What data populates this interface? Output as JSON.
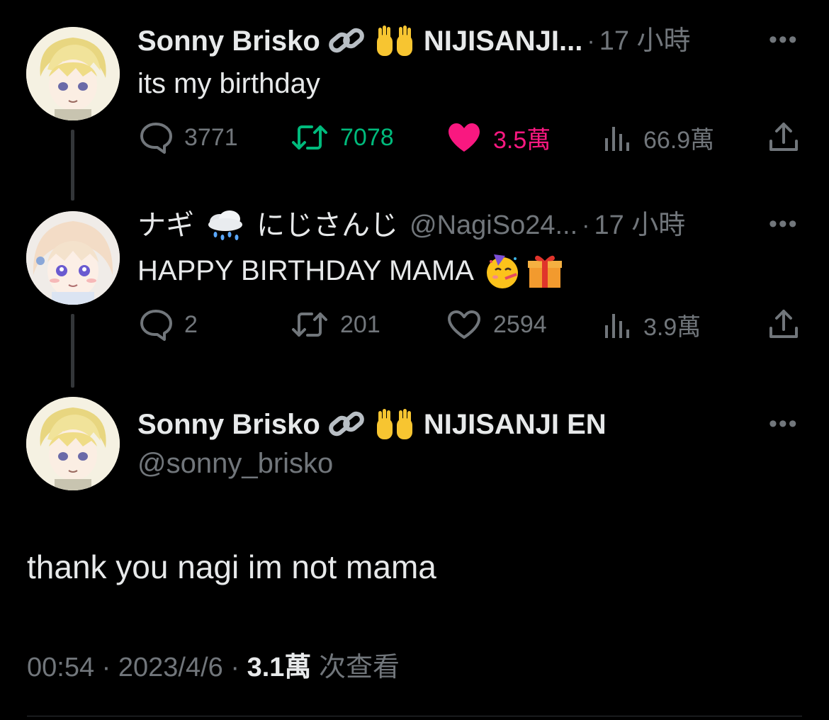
{
  "tweets": [
    {
      "name": "Sonny Brisko",
      "affiliation": "NIJISANJI...",
      "time": "17 小時",
      "text": "its my birthday",
      "replies": "3771",
      "retweets": "7078",
      "likes": "3.5萬",
      "views": "66.9萬"
    },
    {
      "name": "ナギ",
      "affiliation": "にじさんじ",
      "handle": "@NagiSo24...",
      "time": "17 小時",
      "text": "HAPPY BIRTHDAY MAMA",
      "replies": "2",
      "retweets": "201",
      "likes": "2594",
      "views": "3.9萬"
    }
  ],
  "main_tweet": {
    "name": "Sonny Brisko",
    "affiliation": "NIJISANJI EN",
    "handle": "@sonny_brisko",
    "text": "thank you nagi im not mama",
    "time": "00:54",
    "date": "2023/4/6",
    "views_count": "3.1萬",
    "views_label": "次查看"
  },
  "colors": {
    "background": "#000000",
    "text": "#e7e9ea",
    "muted": "#71767b",
    "retweet_active": "#00ba7c",
    "like_active": "#f91880"
  },
  "icons": [
    "link-icon",
    "raising-hands-icon",
    "cloud-rain-icon",
    "partying-face-icon",
    "gift-icon",
    "reply-icon",
    "retweet-icon",
    "like-icon",
    "views-icon",
    "share-icon",
    "more-icon"
  ]
}
